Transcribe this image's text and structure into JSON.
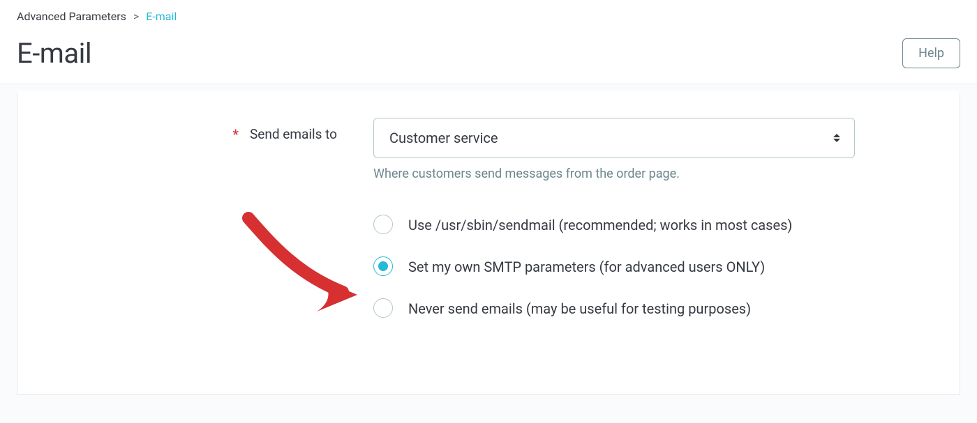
{
  "breadcrumb": {
    "parent": "Advanced Parameters",
    "current": "E-mail"
  },
  "page": {
    "title": "E-mail"
  },
  "buttons": {
    "help": "Help"
  },
  "form": {
    "send_emails_label": "Send emails to",
    "send_emails_value": "Customer service",
    "send_emails_hint": "Where customers send messages from the order page.",
    "radio_options": [
      "Use /usr/sbin/sendmail (recommended; works in most cases)",
      "Set my own SMTP parameters (for advanced users ONLY)",
      "Never send emails (may be useful for testing purposes)"
    ],
    "radio_selected_index": 1
  },
  "colors": {
    "accent": "#25b9d7",
    "annotation": "#d63031"
  }
}
